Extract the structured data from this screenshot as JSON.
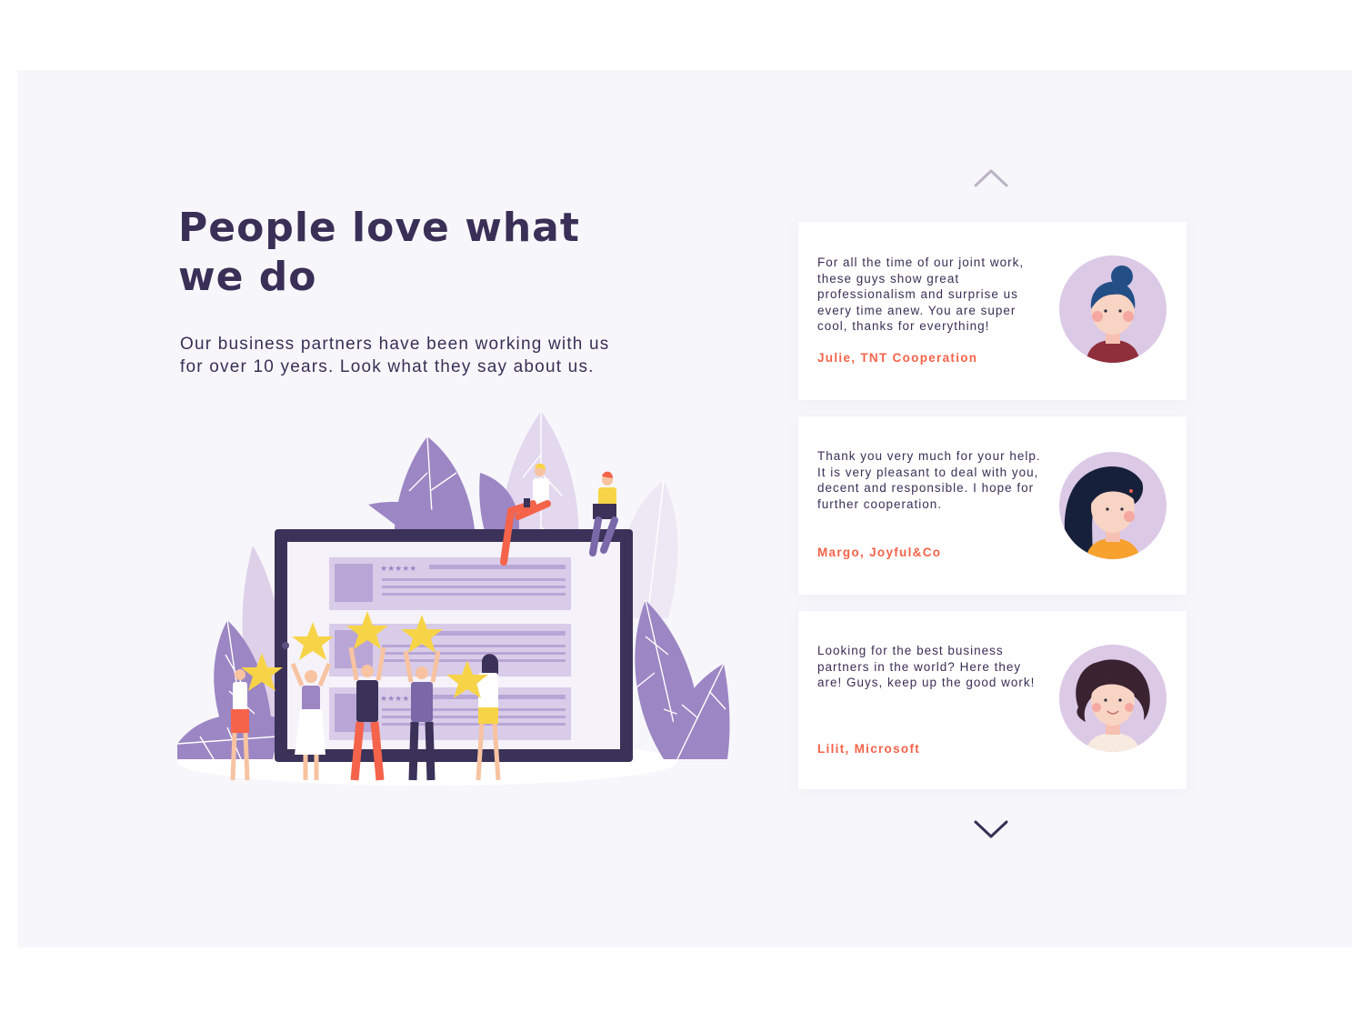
{
  "section": {
    "title": "People love what we do",
    "description": "Our business partners have been working with us for over 10 years. Look what they say about us."
  },
  "testimonials": [
    {
      "quote": "For all the time of our joint work, these guys show great professionalism and surprise us every time anew. You are super cool, thanks for everything!",
      "author": "Julie, TNT Cooperation",
      "avatar_icon": "woman-bun-avatar-icon"
    },
    {
      "quote": "Thank you very much for your help. It is very pleasant to deal with you, decent and responsible. I hope for further cooperation.",
      "author": "Margo, Joyful&Co",
      "avatar_icon": "woman-dark-hair-avatar-icon"
    },
    {
      "quote": "Looking for the best business partners in the world? Here they are! Guys, keep up the good work!",
      "author": "Lilit, Microsoft",
      "avatar_icon": "woman-curly-hair-avatar-icon"
    }
  ],
  "navigation": {
    "prev_icon": "chevron-up-icon",
    "next_icon": "chevron-down-icon"
  },
  "colors": {
    "heading": "#3a2f56",
    "author_accent": "#f4634a",
    "avatar_background": "#dbc9e6",
    "leaf_purple": "#9d86c4",
    "star_yellow": "#f7d447",
    "page_background": "#f7f7fb"
  },
  "illustration": {
    "icon": "customer-rating-illustration-icon",
    "star_rating_max": 5
  }
}
